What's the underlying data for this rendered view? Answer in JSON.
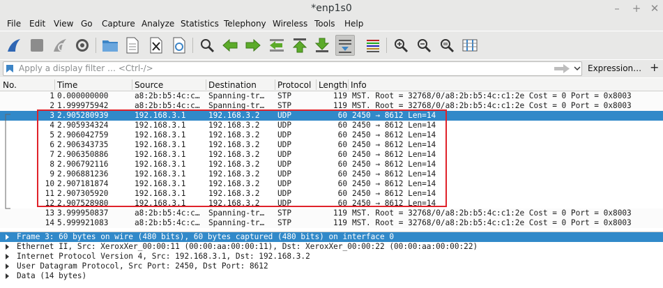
{
  "window": {
    "title": "*enp1s0",
    "controls": {
      "minimize": "–",
      "maximize": "+",
      "close": "✕"
    }
  },
  "menu": [
    "File",
    "Edit",
    "View",
    "Go",
    "Capture",
    "Analyze",
    "Statistics",
    "Telephony",
    "Wireless",
    "Tools",
    "Help"
  ],
  "toolbar": {
    "icons": [
      "shark-fin-start-icon",
      "stop-square-icon",
      "restart-fin-icon",
      "capture-options-gear-icon",
      "open-folder-icon",
      "file-save-icon",
      "close-file-icon",
      "reload-icon",
      "find-packet-icon",
      "go-back-arrow-icon",
      "go-forward-arrow-icon",
      "go-to-packet-icon",
      "go-first-packet-icon",
      "go-last-packet-icon",
      "auto-scroll-icon",
      "colorize-icon",
      "zoom-in-icon",
      "zoom-out-icon",
      "zoom-normal-icon",
      "resize-columns-icon"
    ]
  },
  "filter": {
    "placeholder": "Apply a display filter … <Ctrl-/>",
    "expression_label": "Expression…",
    "add_label": "+"
  },
  "columns": [
    "No.",
    "Time",
    "Source",
    "Destination",
    "Protocol",
    "Length",
    "Info"
  ],
  "packets": [
    {
      "no": "1",
      "time": "0.000000000",
      "src": "a8:2b:b5:4c:c…",
      "dst": "Spanning-tr…",
      "proto": "STP",
      "len": "119",
      "info": "MST. Root = 32768/0/a8:2b:b5:4c:c1:2e  Cost = 0  Port = 0x8003"
    },
    {
      "no": "2",
      "time": "1.999975942",
      "src": "a8:2b:b5:4c:c…",
      "dst": "Spanning-tr…",
      "proto": "STP",
      "len": "119",
      "info": "MST. Root = 32768/0/a8:2b:b5:4c:c1:2e  Cost = 0  Port = 0x8003"
    },
    {
      "no": "3",
      "time": "2.905280939",
      "src": "192.168.3.1",
      "dst": "192.168.3.2",
      "proto": "UDP",
      "len": "60",
      "info": "2450 → 8612 Len=14"
    },
    {
      "no": "4",
      "time": "2.905934324",
      "src": "192.168.3.1",
      "dst": "192.168.3.2",
      "proto": "UDP",
      "len": "60",
      "info": "2450 → 8612 Len=14"
    },
    {
      "no": "5",
      "time": "2.906042759",
      "src": "192.168.3.1",
      "dst": "192.168.3.2",
      "proto": "UDP",
      "len": "60",
      "info": "2450 → 8612 Len=14"
    },
    {
      "no": "6",
      "time": "2.906343735",
      "src": "192.168.3.1",
      "dst": "192.168.3.2",
      "proto": "UDP",
      "len": "60",
      "info": "2450 → 8612 Len=14"
    },
    {
      "no": "7",
      "time": "2.906350886",
      "src": "192.168.3.1",
      "dst": "192.168.3.2",
      "proto": "UDP",
      "len": "60",
      "info": "2450 → 8612 Len=14"
    },
    {
      "no": "8",
      "time": "2.906792116",
      "src": "192.168.3.1",
      "dst": "192.168.3.2",
      "proto": "UDP",
      "len": "60",
      "info": "2450 → 8612 Len=14"
    },
    {
      "no": "9",
      "time": "2.906881236",
      "src": "192.168.3.1",
      "dst": "192.168.3.2",
      "proto": "UDP",
      "len": "60",
      "info": "2450 → 8612 Len=14"
    },
    {
      "no": "10",
      "time": "2.907181874",
      "src": "192.168.3.1",
      "dst": "192.168.3.2",
      "proto": "UDP",
      "len": "60",
      "info": "2450 → 8612 Len=14"
    },
    {
      "no": "11",
      "time": "2.907305920",
      "src": "192.168.3.1",
      "dst": "192.168.3.2",
      "proto": "UDP",
      "len": "60",
      "info": "2450 → 8612 Len=14"
    },
    {
      "no": "12",
      "time": "2.907528980",
      "src": "192.168.3.1",
      "dst": "192.168.3.2",
      "proto": "UDP",
      "len": "60",
      "info": "2450 → 8612 Len=14"
    },
    {
      "no": "13",
      "time": "3.999950837",
      "src": "a8:2b:b5:4c:c…",
      "dst": "Spanning-tr…",
      "proto": "STP",
      "len": "119",
      "info": "MST. Root = 32768/0/a8:2b:b5:4c:c1:2e  Cost = 0  Port = 0x8003"
    },
    {
      "no": "14",
      "time": "5.999921083",
      "src": "a8:2b:b5:4c:c…",
      "dst": "Spanning-tr…",
      "proto": "STP",
      "len": "119",
      "info": "MST. Root = 32768/0/a8:2b:b5:4c:c1:2e  Cost = 0  Port = 0x8003"
    }
  ],
  "selected_packet": "3",
  "details": [
    "Frame 3: 60 bytes on wire (480 bits), 60 bytes captured (480 bits) on interface 0",
    "Ethernet II, Src: XeroxXer_00:00:11 (00:00:aa:00:00:11), Dst: XeroxXer_00:00:22 (00:00:aa:00:00:22)",
    "Internet Protocol Version 4, Src: 192.168.3.1, Dst: 192.168.3.2",
    "User Datagram Protocol, Src Port: 2450, Dst Port: 8612",
    "Data (14 bytes)"
  ],
  "colors": {
    "selection": "#3189c9",
    "highlight_box": "#e0222a",
    "chrome": "#e8e8e7"
  }
}
